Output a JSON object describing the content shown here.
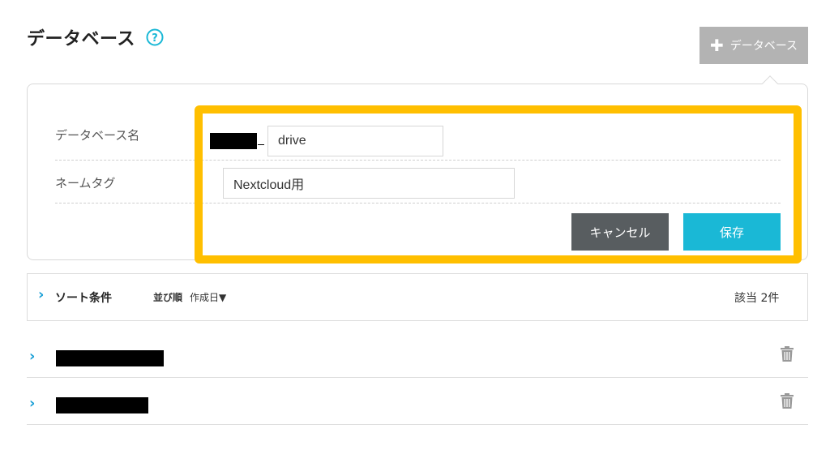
{
  "header": {
    "title": "データベース",
    "add_button_label": "データベース"
  },
  "form": {
    "name_label": "データベース名",
    "name_value": "drive",
    "tag_label": "ネームタグ",
    "tag_value": "Nextcloud用",
    "cancel_label": "キャンセル",
    "save_label": "保存"
  },
  "sort": {
    "title": "ソート条件",
    "order_label": "並び順",
    "order_value": "作成日▼",
    "count": "該当 2件"
  },
  "list": {
    "items": [
      {
        "name": ""
      },
      {
        "name": ""
      }
    ]
  },
  "colors": {
    "accent": "#1ab8d6",
    "highlight": "#ffbf00",
    "cancel": "#585d60",
    "add_button": "#b3b3b3"
  }
}
